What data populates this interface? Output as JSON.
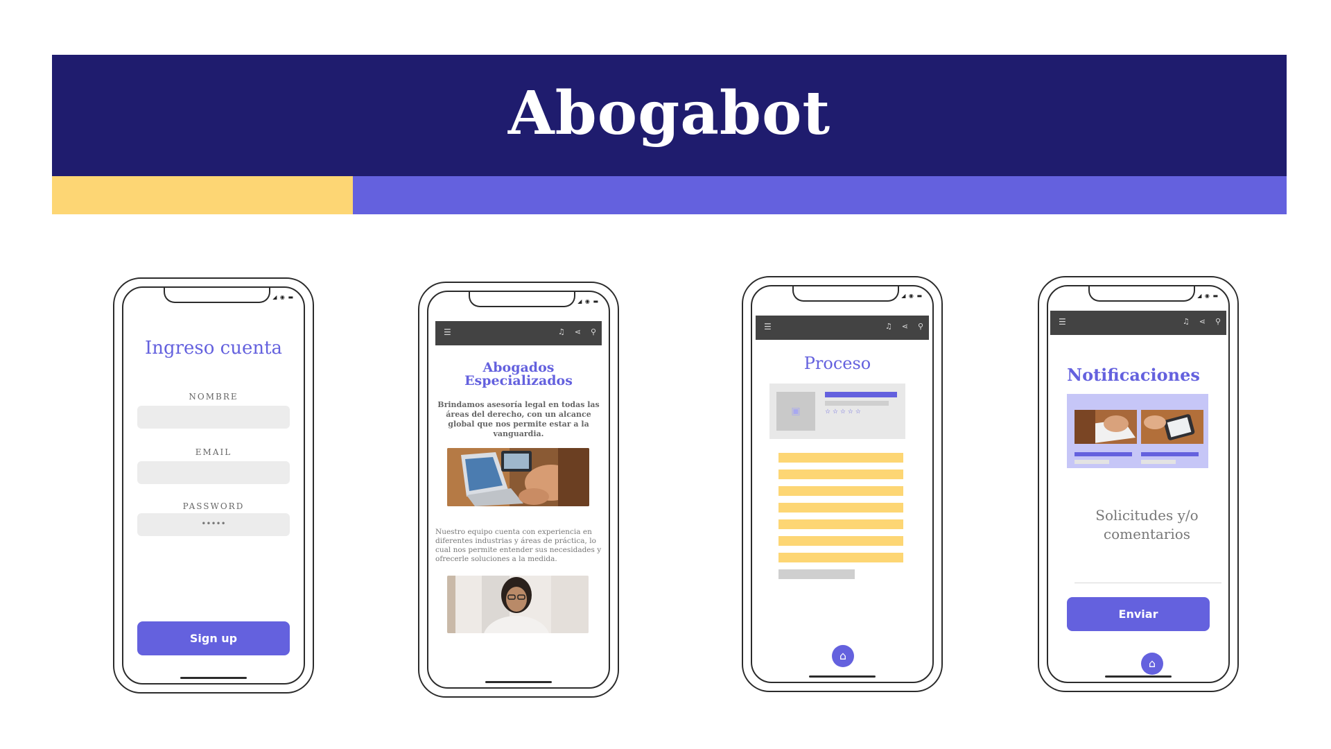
{
  "title": "Abogabot",
  "colors": {
    "navy": "#1f1c6e",
    "accent": "#6461de",
    "yellow": "#fdd674",
    "frame": "#2b2b2b"
  },
  "status_icons": [
    "signal-icon",
    "wifi-icon",
    "battery-icon"
  ],
  "login": {
    "title": "Ingreso cuenta",
    "name_label": "NOMBRE",
    "email_label": "EMAIL",
    "password_label": "PASSWORD",
    "password_value": "•••••",
    "signup": "Sign up"
  },
  "lawyers": {
    "title": "Abogados Especializados",
    "intro": "Brindamos asesoría legal en todas las áreas del derecho, con un alcance global que nos permite estar a la vanguardia.",
    "body": "Nuestro equipo cuenta con experiencia en diferentes industrias y áreas de práctica, lo cual nos permite entender sus necesidades y ofrecerle soluciones a la medida."
  },
  "process": {
    "title": "Proceso",
    "rating": "☆ ☆ ☆ ☆ ☆"
  },
  "notifications": {
    "title": "Notificaciones",
    "requests": "Solicitudes y/o comentarios",
    "send": "Enviar"
  }
}
